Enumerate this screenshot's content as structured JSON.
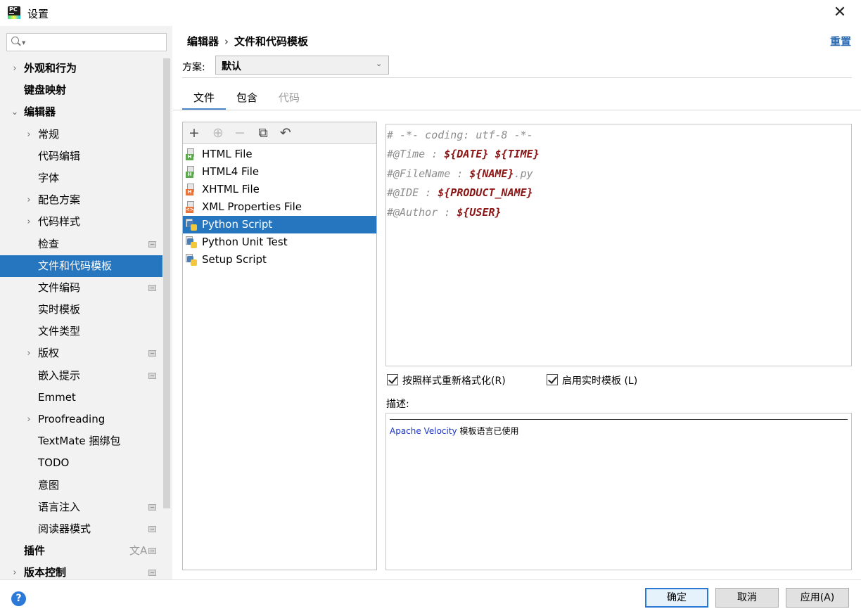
{
  "window": {
    "title": "设置",
    "close_glyph": "✕"
  },
  "search": {
    "placeholder": "",
    "icon": "search-icon"
  },
  "sidebar": {
    "items": [
      {
        "label": "外观和行为",
        "bold": true,
        "chevron": "›",
        "badge": false
      },
      {
        "label": "键盘映射",
        "bold": true,
        "chevron": "",
        "badge": false
      },
      {
        "label": "编辑器",
        "bold": true,
        "chevron": "⌄",
        "badge": false
      },
      {
        "label": "常规",
        "bold": false,
        "chevron": "›",
        "badge": false
      },
      {
        "label": "代码编辑",
        "bold": false,
        "chevron": "",
        "badge": false
      },
      {
        "label": "字体",
        "bold": false,
        "chevron": "",
        "badge": false
      },
      {
        "label": "配色方案",
        "bold": false,
        "chevron": "›",
        "badge": false
      },
      {
        "label": "代码样式",
        "bold": false,
        "chevron": "›",
        "badge": false
      },
      {
        "label": "检查",
        "bold": false,
        "chevron": "",
        "badge": true
      },
      {
        "label": "文件和代码模板",
        "bold": false,
        "chevron": "",
        "badge": false,
        "selected": true
      },
      {
        "label": "文件编码",
        "bold": false,
        "chevron": "",
        "badge": true
      },
      {
        "label": "实时模板",
        "bold": false,
        "chevron": "",
        "badge": false
      },
      {
        "label": "文件类型",
        "bold": false,
        "chevron": "",
        "badge": false
      },
      {
        "label": "版权",
        "bold": false,
        "chevron": "›",
        "badge": true
      },
      {
        "label": "嵌入提示",
        "bold": false,
        "chevron": "",
        "badge": true
      },
      {
        "label": "Emmet",
        "bold": false,
        "chevron": "",
        "badge": false
      },
      {
        "label": "Proofreading",
        "bold": false,
        "chevron": "›",
        "badge": false
      },
      {
        "label": "TextMate 捆绑包",
        "bold": false,
        "chevron": "",
        "badge": false
      },
      {
        "label": "TODO",
        "bold": false,
        "chevron": "",
        "badge": false
      },
      {
        "label": "意图",
        "bold": false,
        "chevron": "",
        "badge": false
      },
      {
        "label": "语言注入",
        "bold": false,
        "chevron": "",
        "badge": true
      },
      {
        "label": "阅读器模式",
        "bold": false,
        "chevron": "",
        "badge": true
      },
      {
        "label": "插件",
        "bold": true,
        "chevron": "",
        "badge": true,
        "lang_icon": "文A"
      },
      {
        "label": "版本控制",
        "bold": true,
        "chevron": "›",
        "badge": true
      }
    ]
  },
  "header": {
    "breadcrumb": [
      "编辑器",
      "文件和代码模板"
    ],
    "breadcrumb_sep": "›",
    "reset_label": "重置"
  },
  "scheme": {
    "label": "方案:",
    "value": "默认",
    "arrow": "⌄"
  },
  "tabs": [
    {
      "label": "文件",
      "active": true,
      "disabled": false
    },
    {
      "label": "包含",
      "active": false,
      "disabled": false
    },
    {
      "label": "代码",
      "active": false,
      "disabled": true
    }
  ],
  "toolbar": {
    "add": "+",
    "add_child": "⊕",
    "remove": "−",
    "copy": "⧉",
    "revert": "↶"
  },
  "templates": [
    {
      "label": "HTML File",
      "icon": "html-file-icon",
      "tag": "H",
      "tag_color": "#5ea950"
    },
    {
      "label": "HTML4 File",
      "icon": "html4-file-icon",
      "tag": "H",
      "tag_color": "#5ea950"
    },
    {
      "label": "XHTML File",
      "icon": "xhtml-file-icon",
      "tag": "H",
      "tag_color": "#e7743a"
    },
    {
      "label": "XML Properties File",
      "icon": "xml-file-icon",
      "tag": "<>",
      "tag_color": "#e7743a"
    },
    {
      "label": "Python Script",
      "icon": "python-file-icon",
      "tag": "",
      "tag_color": "",
      "selected": true
    },
    {
      "label": "Python Unit Test",
      "icon": "python-file-icon",
      "tag": "",
      "tag_color": ""
    },
    {
      "label": "Setup Script",
      "icon": "python-file-icon",
      "tag": "",
      "tag_color": ""
    }
  ],
  "editor": {
    "lines": [
      [
        {
          "t": "# -*- coding: utf-8 -*-",
          "k": "comment"
        }
      ],
      [
        {
          "t": "#@Time : ",
          "k": "comment"
        },
        {
          "t": "${DATE}",
          "k": "var"
        },
        {
          "t": " ",
          "k": "comment"
        },
        {
          "t": "${TIME}",
          "k": "var"
        }
      ],
      [
        {
          "t": "#@FileName : ",
          "k": "comment"
        },
        {
          "t": "${NAME}",
          "k": "var"
        },
        {
          "t": ".py",
          "k": "comment"
        }
      ],
      [
        {
          "t": "#@IDE : ",
          "k": "comment"
        },
        {
          "t": "${PRODUCT_NAME}",
          "k": "var"
        }
      ],
      [
        {
          "t": "#@Author : ",
          "k": "comment"
        },
        {
          "t": "${USER}",
          "k": "var"
        }
      ]
    ]
  },
  "options": {
    "reformat": {
      "label": "按照样式重新格式化(R)",
      "checked": true
    },
    "live_templates": {
      "label": "启用实时模板 (L)",
      "checked": true
    }
  },
  "description": {
    "label": "描述:",
    "link": "Apache Velocity",
    "text": " 模板语言已使用"
  },
  "footer": {
    "ok": "确定",
    "cancel": "取消",
    "apply": "应用(A)",
    "help": "?"
  },
  "colors": {
    "selection": "#2675bf",
    "link": "#2d6bb1",
    "template_var": "#8b1414",
    "comment": "#8c8c8c"
  }
}
